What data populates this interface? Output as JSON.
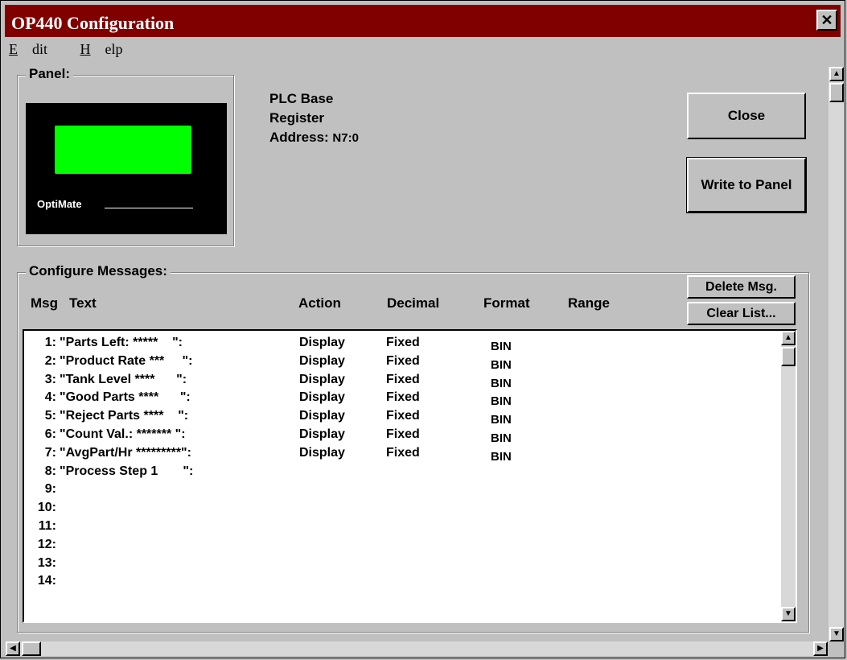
{
  "window": {
    "title": "OP440 Configuration",
    "close_glyph": "✕"
  },
  "menu": {
    "edit": "Edit",
    "help": "Help"
  },
  "panel": {
    "label": "Panel:",
    "logo_text": "OptiMate"
  },
  "plc": {
    "line1": "PLC Base",
    "line2": "Register",
    "address_label": "Address:",
    "address_value": "N7:0"
  },
  "buttons": {
    "close": "Close",
    "write": "Write to Panel",
    "delete": "Delete Msg.",
    "clear": "Clear List..."
  },
  "messages": {
    "label": "Configure Messages:",
    "columns": {
      "msg": "Msg",
      "text": "Text",
      "action": "Action",
      "decimal": "Decimal",
      "format": "Format",
      "range": "Range"
    },
    "rows": [
      {
        "num": "1:",
        "text": "\"Parts Left: *****    \":",
        "action": "Display",
        "decimal": "Fixed",
        "format": "BIN"
      },
      {
        "num": "2:",
        "text": "\"Product Rate ***     \":",
        "action": "Display",
        "decimal": "Fixed",
        "format": "BIN"
      },
      {
        "num": "3:",
        "text": "\"Tank Level ****      \":",
        "action": "Display",
        "decimal": "Fixed",
        "format": "BIN"
      },
      {
        "num": "4:",
        "text": "\"Good Parts ****      \":",
        "action": "Display",
        "decimal": "Fixed",
        "format": "BIN"
      },
      {
        "num": "5:",
        "text": "\"Reject Parts ****    \":",
        "action": "Display",
        "decimal": "Fixed",
        "format": "BIN"
      },
      {
        "num": "6:",
        "text": "\"Count Val.: ******* \":",
        "action": "Display",
        "decimal": "Fixed",
        "format": "BIN"
      },
      {
        "num": "7:",
        "text": "\"AvgPart/Hr *********\":",
        "action": "Display",
        "decimal": "Fixed",
        "format": "BIN"
      },
      {
        "num": "8:",
        "text": "\"Process Step 1       \":",
        "action": "",
        "decimal": "",
        "format": ""
      },
      {
        "num": "9:",
        "text": "",
        "action": "",
        "decimal": "",
        "format": ""
      },
      {
        "num": "10:",
        "text": "",
        "action": "",
        "decimal": "",
        "format": ""
      },
      {
        "num": "11:",
        "text": "",
        "action": "",
        "decimal": "",
        "format": ""
      },
      {
        "num": "12:",
        "text": "",
        "action": "",
        "decimal": "",
        "format": ""
      },
      {
        "num": "13:",
        "text": "",
        "action": "",
        "decimal": "",
        "format": ""
      },
      {
        "num": "14:",
        "text": "",
        "action": "",
        "decimal": "",
        "format": ""
      }
    ]
  },
  "icons": {
    "up": "▲",
    "down": "▼",
    "left": "◀",
    "right": "▶"
  }
}
